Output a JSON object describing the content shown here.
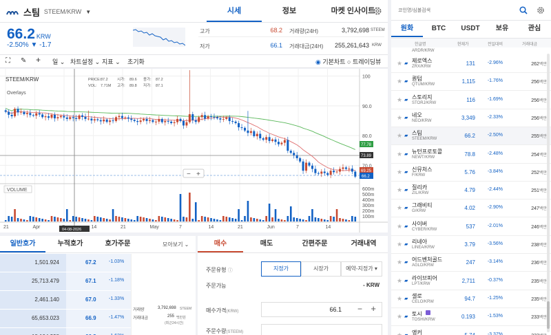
{
  "header": {
    "name": "스팀",
    "symbol": "STEEM/KRW",
    "tabs": [
      "시세",
      "정보",
      "마켓 인사이트"
    ],
    "price": "66.2",
    "price_unit": "KRW",
    "change_pct": "-2.50%",
    "change_abs": "▼ -1.7",
    "high_label": "고가",
    "high": "68.2",
    "low_label": "저가",
    "low": "66.1",
    "vol_label": "거래량(24H)",
    "vol": "3,792,698",
    "vol_unit": "STEEM",
    "amt_label": "거래대금(24H)",
    "amt": "255,261,643",
    "amt_unit": "KRW"
  },
  "toolbar": {
    "period": "일",
    "settings": "차트설정",
    "indicator": "지표",
    "reset": "초기화",
    "basic": "기본차트",
    "tv": "트레이딩뷰"
  },
  "chart": {
    "pair": "STEEM/KRW",
    "overlays": "Overlays",
    "volume": "VOLUME",
    "ohlc": [
      "PRICE:",
      "87.2",
      "시가:",
      "89.6",
      "종가:",
      "87.2",
      "VOL:",
      "7.71M",
      "고가:",
      "89.8",
      "저가:",
      "87.1"
    ],
    "badges": {
      "ma_green": "77.78",
      "cross": "73.89",
      "ma_red": "69.25",
      "last": "66.2"
    },
    "date_tag": "04-08-2026"
  },
  "chart_data": {
    "type": "candlestick",
    "price_ticks": [
      "100",
      "90.0",
      "80.0",
      "70.0"
    ],
    "vol_ticks": [
      "600m",
      "500m",
      "400m",
      "300m",
      "200m",
      "100m"
    ],
    "x_ticks": [
      "21",
      "Apr",
      "7",
      "14",
      "21",
      "May",
      "7",
      "14",
      "21",
      "Jun",
      "7",
      "14"
    ],
    "close": [
      88,
      87,
      86.5,
      89,
      87.8,
      88,
      87.2,
      87.6,
      86.9,
      86.7,
      87.5,
      87.1,
      86.2,
      86.5,
      86,
      87,
      85.8,
      86.2,
      86.6,
      86.1,
      85.6,
      86.2,
      85.9,
      85.6,
      86.8,
      86.3,
      85.6,
      85.7,
      85.1,
      85.5,
      85.2,
      84.8,
      85.4,
      84.6,
      85.1,
      84.9,
      86.2,
      86.6,
      85.9,
      86.1,
      85.7,
      85.3,
      84.9,
      84.6,
      85.1,
      85.6,
      84.9,
      85.2,
      84.6,
      84.7,
      85.6,
      84.5,
      84.9,
      84.7,
      84.2,
      84.5,
      85.6,
      84.9,
      83.4,
      84.5,
      87.2,
      85.2,
      84.6,
      86.2,
      86.9,
      85.7,
      86.5,
      86.3,
      86.2,
      85.8,
      85.4,
      85.6,
      86.1,
      84.9,
      84.7,
      84.2,
      82.8,
      82.6,
      81.7,
      80.9,
      81.5,
      79.8,
      80.6,
      79.1,
      78.6,
      79.5,
      78.2,
      78.7,
      77.9,
      77.1,
      77.6,
      78.5,
      74.9,
      74.2,
      73.4,
      72.4,
      71.3,
      68.2,
      70.9,
      69.9,
      68.8,
      67.4,
      67.2,
      67.9,
      67.4,
      66.8,
      68.2,
      67.7,
      67.9,
      68.8,
      69.3,
      68.8,
      68.9,
      67.9,
      66.2
    ]
  },
  "orderbook": {
    "tabs": [
      "일반호가",
      "누적호가",
      "호가주문"
    ],
    "more": "모아보기",
    "rows": [
      {
        "qty": "1,501.924",
        "price": "67.2",
        "pct": "-1.03%"
      },
      {
        "qty": "25,713.479",
        "price": "67.1",
        "pct": "-1.18%"
      },
      {
        "qty": "2,461.140",
        "price": "67.0",
        "pct": "-1.33%"
      },
      {
        "qty": "65,653.023",
        "price": "66.9",
        "pct": "-1.47%"
      },
      {
        "qty": "18,104.298",
        "price": "66.8",
        "pct": "-1.62%"
      }
    ],
    "info": {
      "vol_label": "거래량",
      "vol": "3,792,698",
      "vol_unit": "STEEM",
      "amt_label": "거래대금",
      "amt": "255",
      "amt_unit": "백만원",
      "note": "(최근24시간)"
    }
  },
  "order": {
    "tabs": [
      "매수",
      "매도",
      "간편주문",
      "거래내역"
    ],
    "type_label": "주문유형",
    "types": [
      "지정가",
      "시장가",
      "예약-지정가"
    ],
    "avail_label": "주문가능",
    "avail": "- KRW",
    "price_label": "매수가격",
    "price_unit": "(KRW)",
    "price": "66.1",
    "qty_label": "주문수량",
    "qty_unit": "(STEEM)"
  },
  "side": {
    "search_placeholder": "코인명/심볼검색",
    "tabs": [
      "원화",
      "BTC",
      "USDT",
      "보유",
      "관심"
    ],
    "cols": [
      "한글명",
      "현재가",
      "전일대비",
      "거래대금"
    ],
    "top_sym": "ARDR/KRW",
    "rows": [
      {
        "name": "제로엑스",
        "sym": "ZRX/KRW",
        "price": "131",
        "pct": "-2.96%",
        "vol": "262"
      },
      {
        "name": "퀀텀",
        "sym": "QTUM/KRW",
        "price": "1,115",
        "pct": "-1.76%",
        "vol": "256"
      },
      {
        "name": "스토리지",
        "sym": "STORJ/KRW",
        "price": "116",
        "pct": "-1.69%",
        "vol": "256"
      },
      {
        "name": "네오",
        "sym": "NEO/KRW",
        "price": "3,349",
        "pct": "-2.33%",
        "vol": "256"
      },
      {
        "name": "스팀",
        "sym": "STEEM/KRW",
        "price": "66.2",
        "pct": "-2.50%",
        "vol": "255"
      },
      {
        "name": "뉴턴프로토콜",
        "sym": "NEWT/KRW",
        "price": "78.8",
        "pct": "-2.48%",
        "vol": "254"
      },
      {
        "name": "신뮤처스",
        "sym": "F/KRW",
        "price": "5.76",
        "pct": "-3.84%",
        "vol": "252"
      },
      {
        "name": "질리카",
        "sym": "ZIL/KRW",
        "price": "4.79",
        "pct": "-2.44%",
        "vol": "251"
      },
      {
        "name": "그래비티",
        "sym": "G/KRW",
        "price": "4.02",
        "pct": "-2.90%",
        "vol": "247"
      },
      {
        "name": "사이버",
        "sym": "CYBER/KRW",
        "price": "537",
        "pct": "-2.01%",
        "vol": "246"
      },
      {
        "name": "리네아",
        "sym": "LINEA/KRW",
        "price": "3.79",
        "pct": "-3.56%",
        "vol": "238"
      },
      {
        "name": "어드벤처골드",
        "sym": "AGLD/KRW",
        "price": "247",
        "pct": "-3.14%",
        "vol": "236"
      },
      {
        "name": "라이브피어",
        "sym": "LPT/KRW",
        "price": "2,711",
        "pct": "-0.37%",
        "vol": "235"
      },
      {
        "name": "셀로",
        "sym": "CELO/KRW",
        "price": "94.7",
        "pct": "-1.25%",
        "vol": "235"
      },
      {
        "name": "토시",
        "sym": "TOSHI/KRW",
        "price": "0.193",
        "pct": "-1.53%",
        "vol": "233"
      },
      {
        "name": "앵커",
        "sym": "",
        "price": "5.74",
        "pct": "-3.37%",
        "vol": "233"
      }
    ],
    "unit": "백만"
  }
}
